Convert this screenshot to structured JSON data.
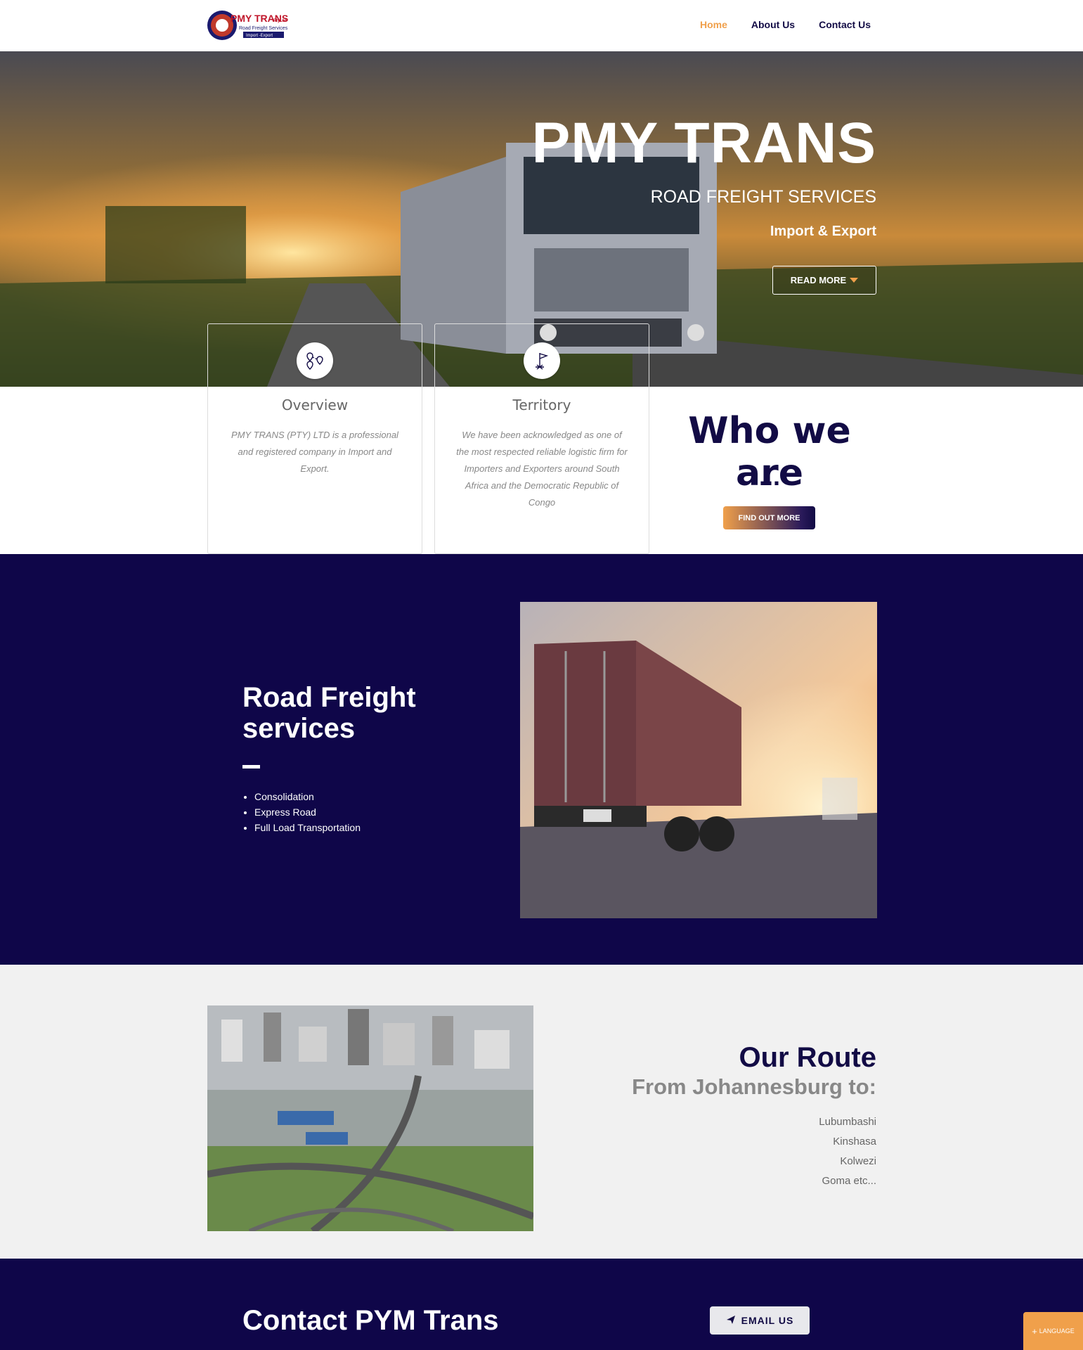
{
  "header": {
    "logo": {
      "title": "PMY TRANS",
      "suffix": "PtyLtd",
      "line1": "Road Freight Services",
      "line2": "Import -Export"
    },
    "nav": [
      {
        "label": "Home",
        "active": true
      },
      {
        "label": "About Us",
        "active": false
      },
      {
        "label": "Contact Us",
        "active": false
      }
    ]
  },
  "hero": {
    "title": "PMY TRANS",
    "subtitle": "ROAD FREIGHT SERVICES",
    "tagline": "Import & Export",
    "cta": "READ MORE"
  },
  "cards": [
    {
      "icon": "map-pins-icon",
      "title": "Overview",
      "text": "PMY TRANS (PTY) LTD is a professional and registered company in Import and Export."
    },
    {
      "icon": "flag-icon",
      "title": "Territory",
      "text": "We have been acknowledged as one of the most respected reliable logistic firm for Importers and Exporters around South Africa and the Democratic Republic of Congo"
    }
  ],
  "who": {
    "title": "Who we are",
    "dots": "...",
    "cta": "FIND OUT MORE"
  },
  "freight": {
    "title": "Road Freight services",
    "items": [
      "Consolidation",
      "Express Road",
      "Full Load Transportation"
    ]
  },
  "route": {
    "title": "Our Route",
    "subtitle": "From Johannesburg to:",
    "cities": [
      "Lubumbashi",
      "Kinshasa",
      "Kolwezi",
      "Goma etc..."
    ]
  },
  "contact": {
    "title": "Contact PYM Trans",
    "email_cta": "EMAIL US"
  },
  "language": {
    "label": "LANGUAGE",
    "prefix": "+"
  },
  "colors": {
    "navy": "#0f0649",
    "orange": "#f0a04b"
  }
}
